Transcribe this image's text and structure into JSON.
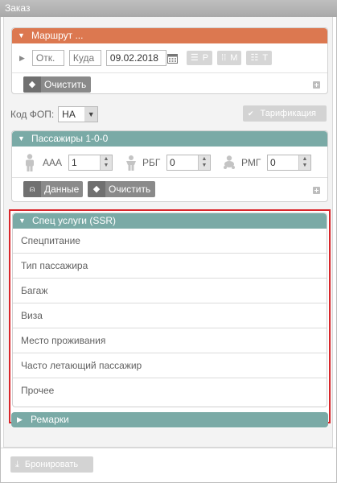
{
  "window": {
    "title": "Заказ"
  },
  "route": {
    "header": "Маршрут ...",
    "from_placeholder": "Отк.",
    "to_placeholder": "Куда",
    "date": "09.02.2018",
    "btn_p": "P",
    "btn_m": "M",
    "btn_t": "T",
    "clear_label": "Очистить"
  },
  "fop": {
    "label": "Код ФОП:",
    "value": "НА",
    "tarification_label": "Тарификация"
  },
  "passengers": {
    "header": "Пассажиры 1-0-0",
    "types": [
      {
        "label": "AAA",
        "count": "1",
        "icon": "adult-icon"
      },
      {
        "label": "РБГ",
        "count": "0",
        "icon": "child-icon"
      },
      {
        "label": "РМГ",
        "count": "0",
        "icon": "infant-icon"
      }
    ],
    "data_label": "Данные",
    "clear_label": "Очистить"
  },
  "ssr": {
    "header": "Спец услуги (SSR)",
    "items": [
      "Спецпитание",
      "Тип пассажира",
      "Багаж",
      "Виза",
      "Место проживания",
      "Часто летающий пассажир",
      "Прочее"
    ],
    "highlight_color": "#d9262b"
  },
  "remarks": {
    "header": "Ремарки"
  },
  "footer": {
    "book_label": "Бронировать"
  },
  "colors": {
    "route_header": "#dc7850",
    "section_header": "#7aaaa6"
  }
}
